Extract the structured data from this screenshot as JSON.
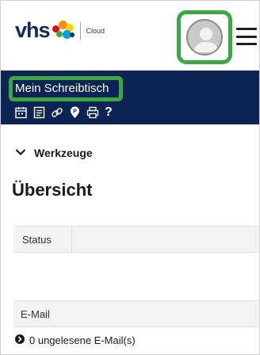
{
  "header": {
    "logo_text": "vhs",
    "logo_sub": "Cloud",
    "brand_colors": [
      "#e30613",
      "#f39200",
      "#ffd500",
      "#3aa843",
      "#009fe3",
      "#0e2c5c"
    ],
    "avatar_icon": "user-avatar-icon",
    "menu_icon": "hamburger-menu-icon",
    "highlight_color": "#3aa843"
  },
  "desk": {
    "title": "Mein Schreibtisch",
    "background": "#0c2453",
    "icons": [
      "calendar-icon",
      "document-icon",
      "link-icon",
      "pin-icon",
      "print-icon",
      "help-icon"
    ],
    "help_label": "?"
  },
  "tools": {
    "label": "Werkzeuge"
  },
  "main": {
    "title": "Übersicht",
    "status_tab": "Status",
    "email_label": "E-Mail",
    "unread_text": "0 ungelesene E-Mail(s)"
  }
}
